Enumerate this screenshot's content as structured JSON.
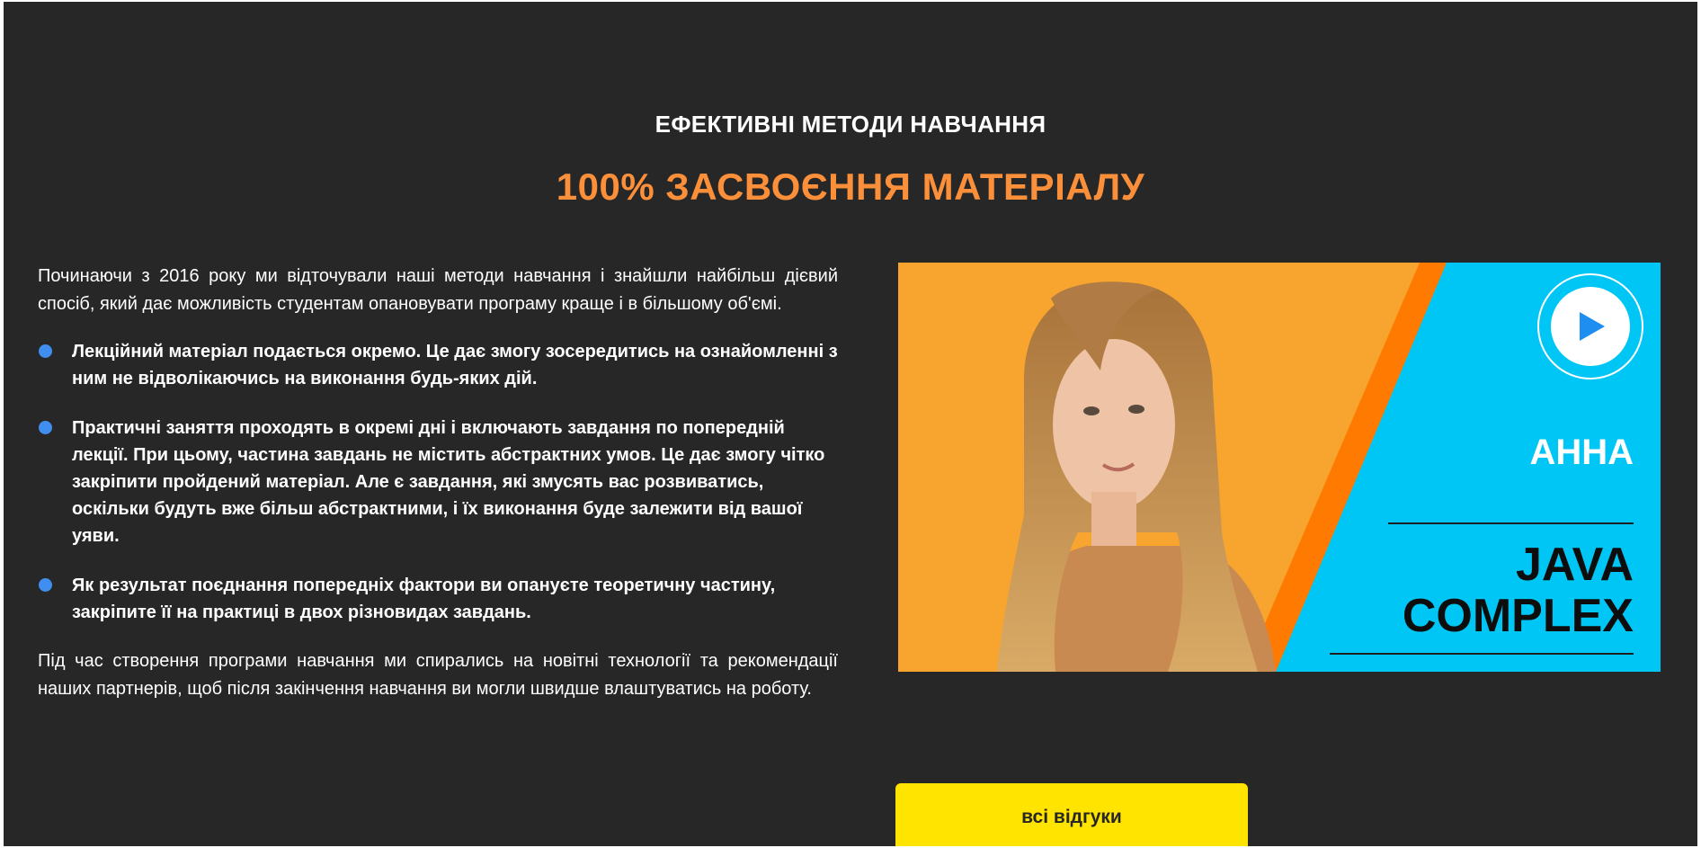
{
  "section": {
    "eyebrow": "ЕФЕКТИВНІ МЕТОДИ НАВЧАННЯ",
    "headline": "100% ЗАСВОЄННЯ МАТЕРІАЛУ",
    "intro": "Починаючи з 2016 року ми відточували наші методи навчання і знайшли найбільш дієвий спосіб, який дає можливість студентам опановувати програму краще і в більшому об'ємі.",
    "bullets": [
      "Лекційний матеріал подається окремо. Це дає змогу зосередитись на ознайомленні з ним не відволікаючись на виконання будь-яких дій.",
      "Практичні заняття проходять в окремі дні і включають завдання по попередній лекції. При цьому, частина завдань не містить абстрактних умов. Це дає змогу чітко закріпити пройдений матеріал. Але є завдання, які змусять вас розвиватись, оскільки будуть вже більш абстрактними, і їх виконання буде залежити від вашої уяви.",
      "Як результат поєднання попередніх фактори ви опануєте теоретичну частину, закріпите її на практиці в двох різновидах завдань."
    ],
    "outro": "Під час створення програми навчання ми спирались на новітні технології та рекомендації наших партнерів, щоб після закінчення навчання ви могли швидше влаштуватись на роботу."
  },
  "video": {
    "name": "АННА",
    "course_line1": "JAVA",
    "course_line2": "COMPLEX",
    "play_icon": "play-icon"
  },
  "cta": {
    "label": "всі відгуки"
  },
  "colors": {
    "background": "#272727",
    "accent_orange": "#fb8f3a",
    "bullet_blue": "#3f8ef0",
    "video_cyan": "#00c6f5",
    "button_yellow": "#ffe400"
  }
}
